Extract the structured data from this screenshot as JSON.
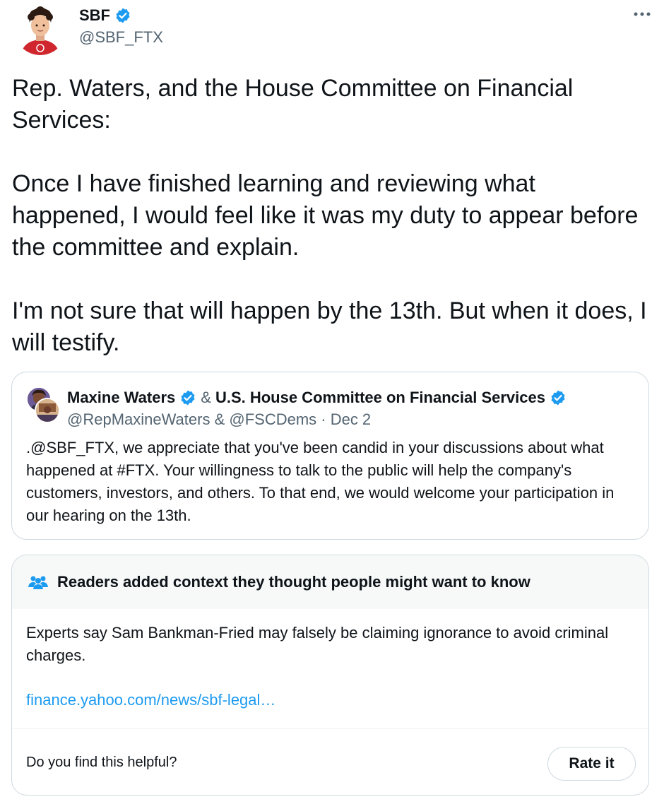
{
  "author": {
    "name": "SBF",
    "handle": "@SBF_FTX",
    "verified": true,
    "avatar_icon": "avatar-cartoon-person"
  },
  "tweet": {
    "paragraphs": [
      "Rep. Waters, and the House Committee on Financial Services:",
      "Once I have finished learning and reviewing what happened, I would feel like it was my duty to appear before the committee and explain.",
      "I'm not sure that will happen by the 13th.  But when it does, I will testify."
    ]
  },
  "quote": {
    "author1": "Maxine Waters",
    "amp": "&",
    "author2": "U.S. House Committee on Financial Services",
    "handles_date": "@RepMaxineWaters & @FSCDems · Dec 2",
    "text": ".@SBF_FTX, we appreciate that you've been candid in your discussions about what happened at #FTX. Your willingness to talk to the public will help the company's customers, investors, and others. To that end, we would welcome your participation in our hearing on the 13th."
  },
  "note": {
    "title": "Readers added context they thought people might want to know",
    "text": "Experts say Sam Bankman-Fried may falsely be claiming ignorance to avoid criminal charges.",
    "link": "finance.yahoo.com/news/sbf-legal…",
    "question": "Do you find this helpful?",
    "rate_label": "Rate it"
  },
  "colors": {
    "verified": "#1d9bf0",
    "link": "#1d9bf0",
    "secondary_text": "#536471",
    "border": "#cfd9de",
    "note_header_bg": "#f7f9f9"
  }
}
